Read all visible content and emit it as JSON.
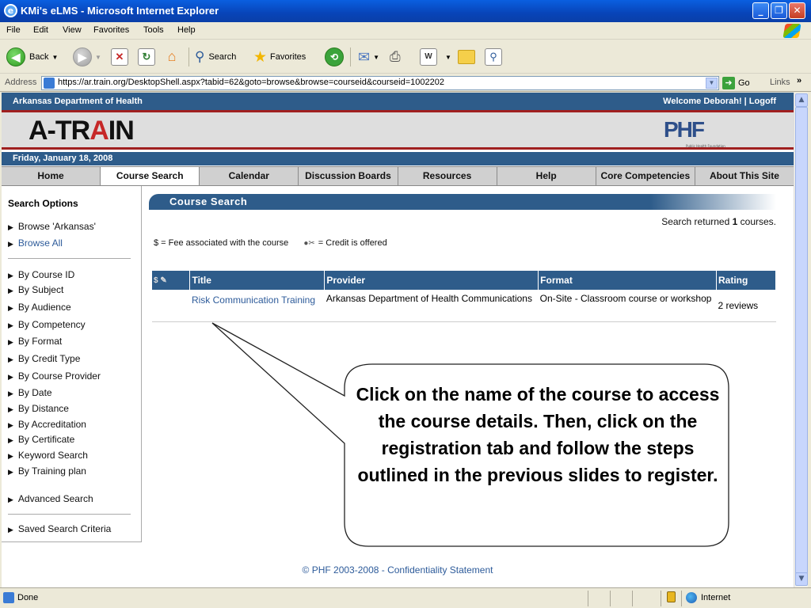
{
  "window": {
    "title": "KMi's eLMS - Microsoft Internet Explorer",
    "min": "_",
    "max": "❐",
    "close": "✕"
  },
  "menu": [
    "File",
    "Edit",
    "View",
    "Favorites",
    "Tools",
    "Help"
  ],
  "toolbar": {
    "back": "Back",
    "search": "Search",
    "favorites": "Favorites"
  },
  "address": {
    "label": "Address",
    "url": "https://ar.train.org/DesktopShell.aspx?tabid=62&goto=browse&browse=courseid&courseid=1002202",
    "go": "Go",
    "links": "Links"
  },
  "site": {
    "org": "Arkansas Department of Health",
    "welcome": "Welcome Deborah! | Logoff",
    "logo_pre": "A-TR",
    "logo_mid": "A",
    "logo_post": "IN",
    "phf_logo": "PHF",
    "phf_sub": "Public Health Foundation",
    "date": "Friday, January 18, 2008"
  },
  "nav": [
    "Home",
    "Course Search",
    "Calendar",
    "Discussion Boards",
    "Resources",
    "Help",
    "Core Competencies",
    "About This Site"
  ],
  "sidebar": {
    "heading": "Search Options",
    "browse": [
      "Browse 'Arkansas'",
      "Browse All"
    ],
    "filters": [
      "By Course ID",
      "By Subject",
      "By Audience",
      "By Competency",
      "By Format",
      "By Credit Type",
      "By Course Provider",
      "By Date",
      "By Distance",
      "By Accreditation",
      "By Certificate",
      "Keyword Search",
      "By Training plan"
    ],
    "advanced": "Advanced Search",
    "saved": "Saved Search Criteria"
  },
  "content": {
    "header": "Course Search",
    "returned_pre": "Search returned",
    "returned_count": "1",
    "returned_post": "courses.",
    "legend_fee": "$ = Fee associated with the course",
    "legend_credit": "= Credit is offered",
    "columns": [
      "$ ✎",
      "Title",
      "Provider",
      "Format",
      "Rating"
    ],
    "rows": [
      {
        "icons": "",
        "title": "Risk Communication Training",
        "provider": "Arkansas Department of Health Communications",
        "format": "On-Site - Classroom course or workshop",
        "rating": "2 reviews"
      }
    ]
  },
  "footer": "© PHF 2003-2008 - Confidentiality Statement",
  "callout": "Click on the name of the course to access the course details. Then, click on the registration tab and follow the steps outlined in the previous slides to register.",
  "status": {
    "text": "Done",
    "zone": "Internet"
  }
}
